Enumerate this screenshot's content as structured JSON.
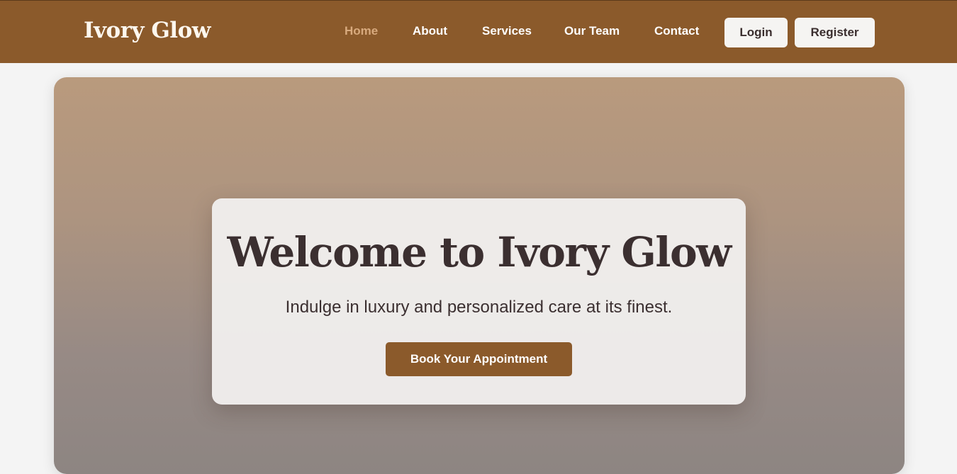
{
  "brand": {
    "name": "Ivory Glow"
  },
  "nav": {
    "items": [
      {
        "label": "Home",
        "active": true
      },
      {
        "label": "About",
        "active": false
      },
      {
        "label": "Services",
        "active": false
      },
      {
        "label": "Our Team",
        "active": false
      },
      {
        "label": "Contact",
        "active": false
      }
    ],
    "login_label": "Login",
    "register_label": "Register"
  },
  "hero": {
    "title": "Welcome to Ivory Glow",
    "subtitle": "Indulge in luxury and personalized care at its finest.",
    "cta_label": "Book Your Appointment"
  },
  "colors": {
    "brand_brown": "#8b5a2b",
    "active_link": "#d8aa7e",
    "text_dark": "#3b2f30",
    "page_background": "#f4f4f4"
  }
}
